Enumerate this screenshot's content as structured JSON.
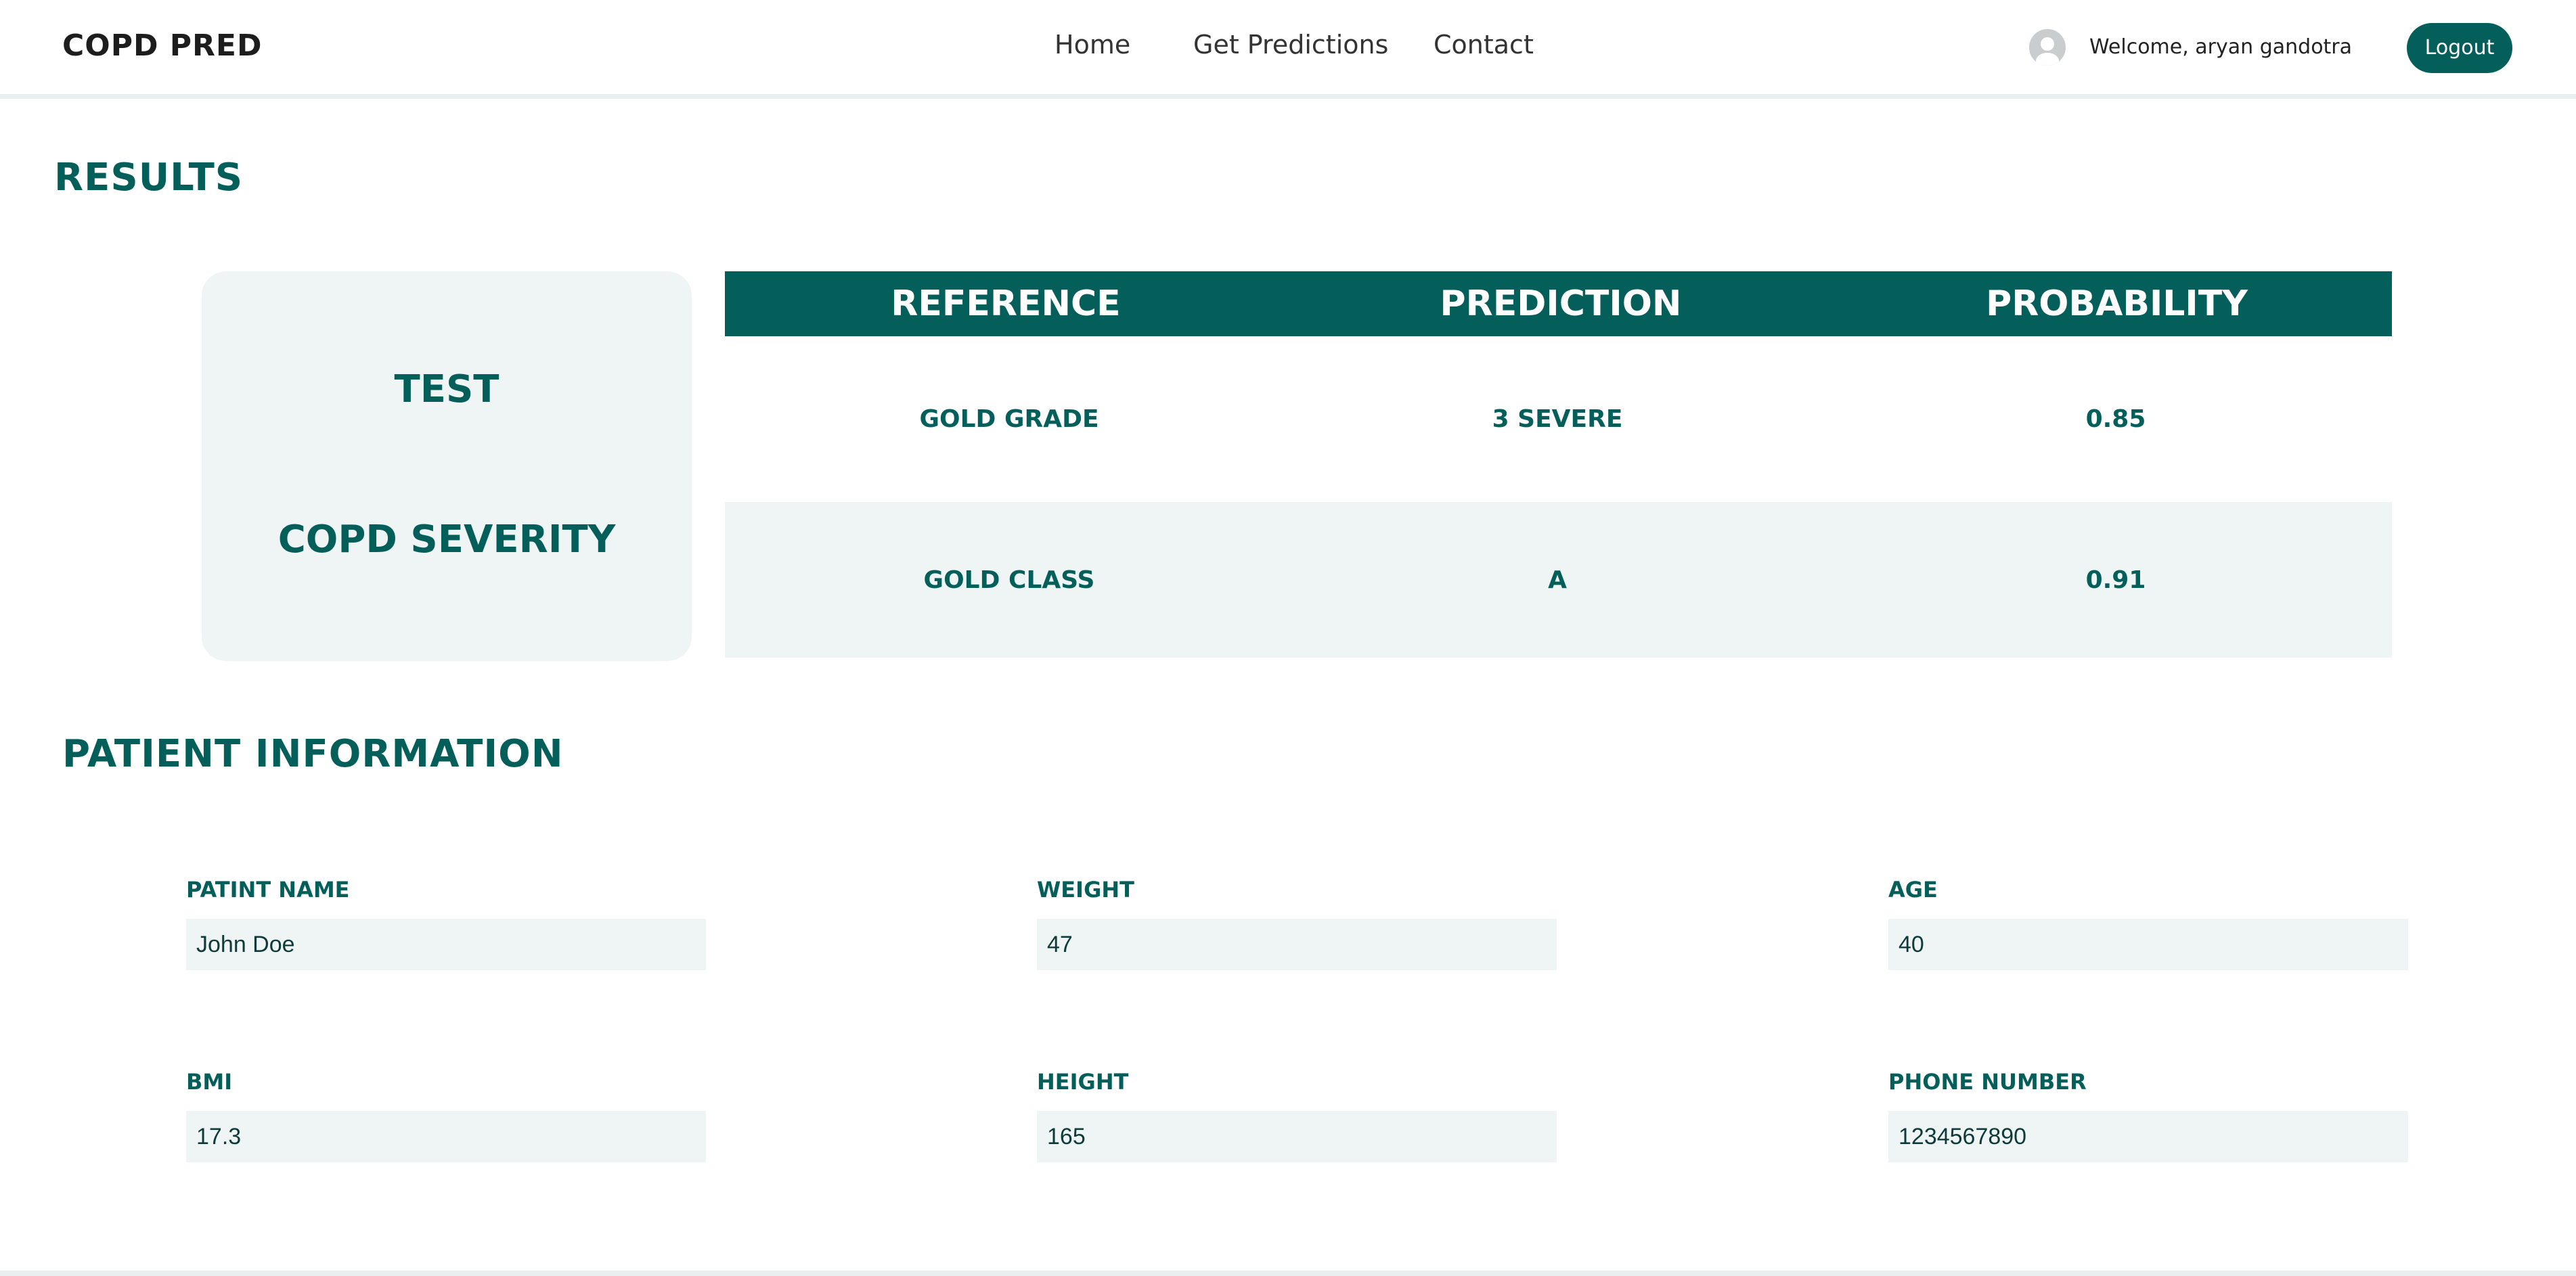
{
  "header": {
    "brand": "COPD PRED",
    "nav": {
      "home": "Home",
      "predictions": "Get Predictions",
      "contact": "Contact"
    },
    "welcome": "Welcome, aryan gandotra",
    "logout_label": "Logout"
  },
  "results": {
    "title": "RESULTS",
    "card": {
      "test_label": "TEST",
      "severity_label": "COPD SEVERITY"
    },
    "table": {
      "headers": [
        "REFERENCE",
        "PREDICTION",
        "PROBABILITY"
      ],
      "rows": [
        [
          "GOLD GRADE",
          "3 SEVERE",
          "0.85"
        ],
        [
          "GOLD CLASS",
          "A",
          "0.91"
        ]
      ]
    }
  },
  "patient": {
    "title": "PATIENT INFORMATION",
    "fields": [
      {
        "label": "PATINT NAME",
        "value": "John Doe"
      },
      {
        "label": "WEIGHT",
        "value": "47"
      },
      {
        "label": "AGE",
        "value": "40"
      },
      {
        "label": "BMI",
        "value": "17.3"
      },
      {
        "label": "HEIGHT",
        "value": "165"
      },
      {
        "label": "PHONE NUMBER",
        "value": "1234567890"
      }
    ]
  },
  "colors": {
    "primary": "#045f5a",
    "panel": "#eff5f4",
    "divider": "#e9eeee"
  },
  "icons": {
    "avatar": "user-avatar-icon"
  }
}
